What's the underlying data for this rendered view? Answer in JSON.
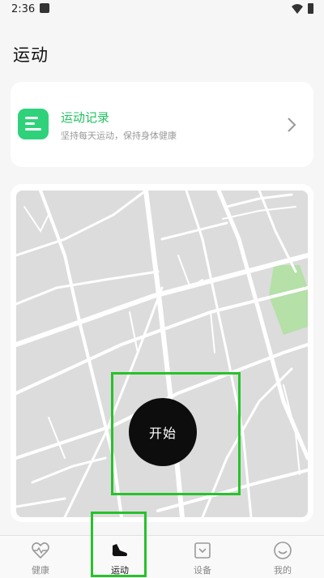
{
  "status_bar": {
    "time": "2:36",
    "icons": [
      "notification-icon",
      "wifi-icon",
      "battery-icon"
    ]
  },
  "page": {
    "title": "运动"
  },
  "record_card": {
    "icon": "list-icon",
    "icon_color": "#2fd27a",
    "title": "运动记录",
    "subtitle": "坚持每天运动，保持身体健康",
    "chevron": "chevron-right-icon"
  },
  "map": {
    "start_label": "开始",
    "highlight_color": "#27c22b"
  },
  "bottom_nav": {
    "active": "运动",
    "items": [
      {
        "label": "健康",
        "icon": "heart-pulse-icon"
      },
      {
        "label": "运动",
        "icon": "sneaker-icon"
      },
      {
        "label": "设备",
        "icon": "device-icon"
      },
      {
        "label": "我的",
        "icon": "smile-icon"
      }
    ]
  },
  "colors": {
    "accent": "#22c162",
    "background": "#f6f6f6",
    "start_button": "#0d0d0d"
  }
}
